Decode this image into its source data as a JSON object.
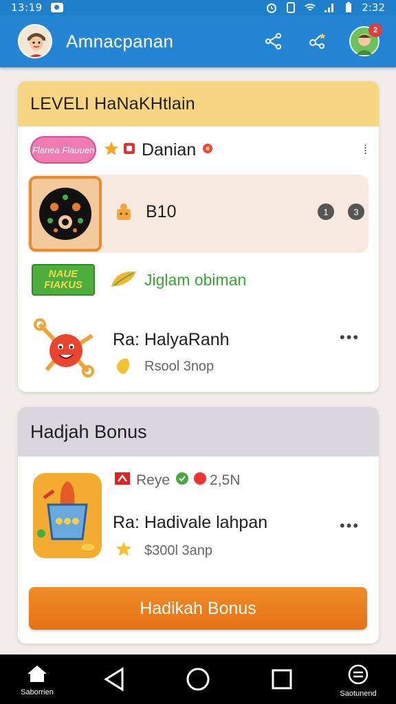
{
  "status_bar": {
    "time_left": "13:19",
    "time_right": "2:32"
  },
  "app_bar": {
    "title": "Amnacpanan",
    "notification_count": "2"
  },
  "level_card": {
    "header": "LEVELI HaNaKHtlain",
    "row1": {
      "tag": "Flanea Flauuen",
      "title": "Danian"
    },
    "row2": {
      "value": "B10",
      "badge1": "1",
      "badge2": "3"
    },
    "row3": {
      "tag": "NAUE FIAKUS",
      "text": "Jiglam obiman"
    },
    "row4": {
      "title": "Ra: HalyaRanh",
      "subtitle": "Rsool 3nop"
    }
  },
  "bonus_card": {
    "header": "Hadjah Bonus",
    "meta_label": "Reye",
    "meta_value": "2,5N",
    "title": "Ra: Hadivale lahpan",
    "subtitle": "$300l 3anp",
    "button_label": "Hadikah Bonus"
  },
  "nav": {
    "left_label": "Saborrien",
    "right_label": "Saotunend"
  }
}
